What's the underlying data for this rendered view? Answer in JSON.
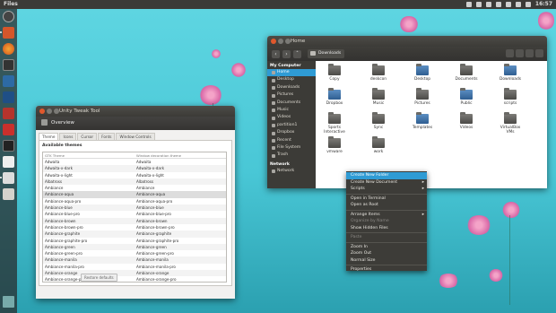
{
  "topbar": {
    "app_name": "Files",
    "time": "16:57",
    "tray_icons": [
      "network-icon",
      "gear-icon",
      "mail-icon",
      "battery-icon",
      "bluetooth-icon",
      "keyboard-icon",
      "volume-icon"
    ]
  },
  "launcher": {
    "icons": [
      "dash-icon",
      "files-icon",
      "firefox-icon",
      "terminal-icon",
      "yakuake-icon",
      "virtualbox-icon",
      "lock-icon",
      "pdf-icon",
      "system-monitor-icon",
      "libreoffice-icon",
      "text-editor-icon",
      "workspace-switcher-icon",
      "trash-icon"
    ]
  },
  "tweak_window": {
    "title": "Unity Tweak Tool",
    "header": "Overview",
    "tabs": [
      "Theme",
      "Icons",
      "Cursor",
      "Fonts",
      "Window Controls"
    ],
    "section_title": "Available themes",
    "columns": [
      "GTK Theme",
      "Window decoration theme"
    ],
    "rows": [
      [
        "Adwaita",
        "Adwaita"
      ],
      [
        "Adwaita-x-dark",
        "Adwaita-x-dark"
      ],
      [
        "Adwaita-x-light",
        "Adwaita-x-light"
      ],
      [
        "Albatross",
        "Albatross"
      ],
      [
        "Ambiance",
        "Ambiance"
      ],
      [
        "Ambiance-aqua",
        "Ambiance-aqua"
      ],
      [
        "Ambiance-aqua-pro",
        "Ambiance-aqua-pro"
      ],
      [
        "Ambiance-blue",
        "Ambiance-blue"
      ],
      [
        "Ambiance-blue-pro",
        "Ambiance-blue-pro"
      ],
      [
        "Ambiance-brown",
        "Ambiance-brown"
      ],
      [
        "Ambiance-brown-pro",
        "Ambiance-brown-pro"
      ],
      [
        "Ambiance-graphite",
        "Ambiance-graphite"
      ],
      [
        "Ambiance-graphite-pro",
        "Ambiance-graphite-pro"
      ],
      [
        "Ambiance-green",
        "Ambiance-green"
      ],
      [
        "Ambiance-green-pro",
        "Ambiance-green-pro"
      ],
      [
        "Ambiance-manila",
        "Ambiance-manila"
      ],
      [
        "Ambiance-manila-pro",
        "Ambiance-manila-pro"
      ],
      [
        "Ambiance-orange",
        "Ambiance-orange"
      ],
      [
        "Ambiance-orange-pro",
        "Ambiance-orange-pro"
      ]
    ],
    "restore_label": "Restore defaults"
  },
  "files_window": {
    "title": "Home",
    "breadcrumb": "Downloads",
    "sidebar": {
      "my_computer": "My Computer",
      "items": [
        "Home",
        "Desktop",
        "Downloads",
        "Pictures",
        "Documents",
        "Music",
        "Videos",
        "partition1",
        "Dropbox",
        "Recent",
        "File System",
        "Trash"
      ],
      "network": "Network",
      "network_items": [
        "Network"
      ]
    },
    "files": [
      "Copy",
      "deskcon",
      "Desktop",
      "Documents",
      "Downloads",
      "Dropbox",
      "Music",
      "Pictures",
      "Public",
      "scripts",
      "Sports Interactive",
      "Sync",
      "Templates",
      "Videos",
      "VirtualBox VMs",
      "vmware",
      "work"
    ]
  },
  "context_menu": {
    "items": [
      {
        "label": "Create New Folder",
        "state": "highlighted"
      },
      {
        "label": "Create New Document",
        "submenu": true
      },
      {
        "label": "Scripts",
        "submenu": true
      },
      {
        "label": "Open in Terminal"
      },
      {
        "label": "Open as Root"
      },
      {
        "label": "Arrange Items",
        "submenu": true
      },
      {
        "label": "Organize by Name",
        "state": "disabled"
      },
      {
        "label": "Show Hidden Files"
      },
      {
        "label": "Paste",
        "state": "disabled"
      },
      {
        "label": "Zoom In"
      },
      {
        "label": "Zoom Out"
      },
      {
        "label": "Normal Size"
      },
      {
        "label": "Properties"
      }
    ]
  },
  "colors": {
    "accent": "#2f9bd4",
    "close": "#e0582c",
    "panel": "#3c3b37"
  }
}
